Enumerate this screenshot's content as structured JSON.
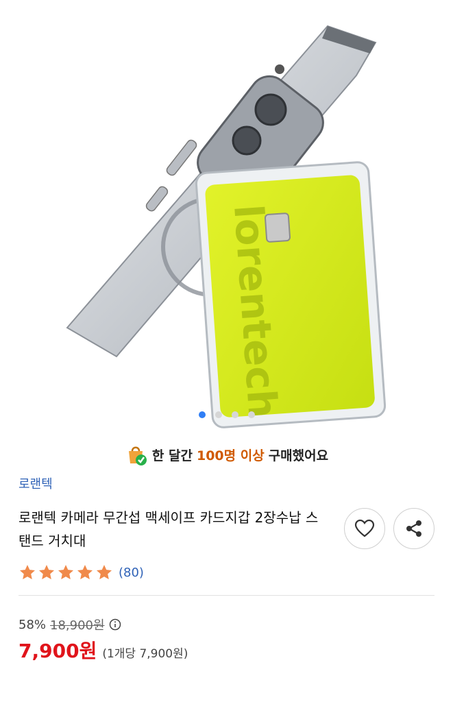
{
  "product_image": {
    "card_brand_text": "lorentech",
    "carousel": {
      "count": 4,
      "active_index": 0
    }
  },
  "purchase_badge": {
    "prefix": "한 달간",
    "highlight": "100명 이상",
    "suffix": "구매했어요"
  },
  "brand": "로랜텍",
  "title": "로랜텍 카메라 무간섭 맥세이프 카드지갑 2장수납 스탠드 거치대",
  "rating": {
    "stars": 5,
    "review_count": "(80)"
  },
  "price": {
    "discount": "58%",
    "original": "18,900원",
    "sale": "7,900원",
    "unit_price": "(1개당 7,900원)"
  },
  "colors": {
    "accent": "#2f62b7",
    "sale": "#e0141b",
    "highlight": "#d05a00",
    "star": "#f08a4b",
    "card": "#d4ea1b"
  }
}
